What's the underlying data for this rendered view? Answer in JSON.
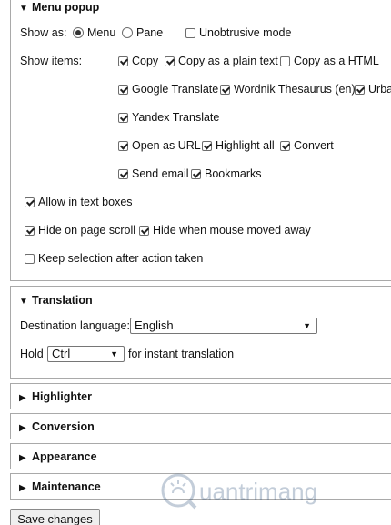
{
  "menu_popup": {
    "title": "Menu popup",
    "show_as_label": "Show as:",
    "show_as_options": [
      {
        "label": "Menu",
        "selected": true
      },
      {
        "label": "Pane",
        "selected": false
      }
    ],
    "unobtrusive_label": "Unobtrusive mode",
    "show_items_label": "Show items:",
    "items": {
      "copy": "Copy",
      "copy_plain": "Copy as a plain text",
      "copy_html": "Copy as a HTML",
      "google": "Google Translate",
      "wordnik": "Wordnik Thesaurus (en)",
      "urban": "Urba",
      "yandex": "Yandex Translate",
      "open_url": "Open as URL",
      "highlight_all": "Highlight all",
      "convert": "Convert",
      "send_email": "Send email",
      "bookmarks": "Bookmarks"
    },
    "allow_text_boxes": "Allow in text boxes",
    "hide_on_scroll": "Hide on page scroll",
    "hide_mouse_away": "Hide when mouse moved away",
    "keep_selection": "Keep selection after action taken"
  },
  "translation": {
    "title": "Translation",
    "dest_label": "Destination language:",
    "dest_value": "English",
    "hold_label": "Hold",
    "hold_value": "Ctrl",
    "hold_suffix": "for instant translation"
  },
  "sections": {
    "highlighter": "Highlighter",
    "conversion": "Conversion",
    "appearance": "Appearance",
    "maintenance": "Maintenance"
  },
  "save_label": "Save changes",
  "watermark_text": "uantrimang"
}
